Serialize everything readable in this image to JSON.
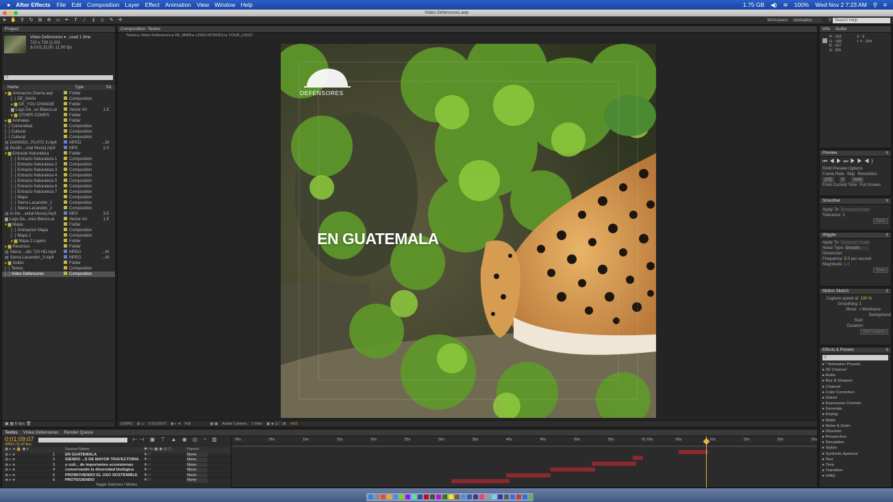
{
  "menubar": {
    "app": "After Effects",
    "items": [
      "File",
      "Edit",
      "Composition",
      "Layer",
      "Effect",
      "Animation",
      "View",
      "Window",
      "Help"
    ],
    "status": [
      "1.75 GB",
      "100%",
      "Wed Nov 2  7:23 AM"
    ]
  },
  "window_title": "Video Defensores.aep",
  "workspace": {
    "label": "Workspace:",
    "value": "Animation",
    "search_placeholder": "Search Help"
  },
  "project": {
    "tab": "Project",
    "comp_name": "Video Defensores ▾ , used 1 time",
    "comp_size": "720 x 720 (1.00)",
    "comp_duration": "Δ 0;01;21;00, 11.00 fps",
    "search_placeholder": "",
    "col_name": "Name",
    "col_type": "Type",
    "col_size": "Siz",
    "rows": [
      {
        "name": "Animacion Diarria.aep",
        "type": "Folder",
        "size": "",
        "color": "#c7b93a",
        "depth": 0,
        "icon": "▾ ▆"
      },
      {
        "name": "DE_MAIN",
        "type": "Composition",
        "size": "",
        "color": "#c7b93a",
        "depth": 1,
        "icon": "[··]"
      },
      {
        "name": "DE_YOU CHANGE",
        "type": "Folder",
        "size": "",
        "color": "#c7b93a",
        "depth": 1,
        "icon": "▸ ▆"
      },
      {
        "name": "Logo De...es Blanco.ai",
        "type": "Vector Art",
        "size": "1.5",
        "color": "#c7b93a",
        "depth": 1,
        "icon": "▆"
      },
      {
        "name": "OTHER COMPS",
        "type": "Folder",
        "size": "",
        "color": "#c7b93a",
        "depth": 1,
        "icon": "▸ ▆"
      },
      {
        "name": "Animales",
        "type": "Folder",
        "size": "",
        "color": "#c7b93a",
        "depth": 0,
        "icon": "▸ ▆"
      },
      {
        "name": "Comunidad",
        "type": "Composition",
        "size": "",
        "color": "#c7b93a",
        "depth": 0,
        "icon": "[··]"
      },
      {
        "name": "Cultural",
        "type": "Composition",
        "size": "",
        "color": "#c7b93a",
        "depth": 0,
        "icon": "[··]"
      },
      {
        "name": "Cultural",
        "type": "Composition",
        "size": "",
        "color": "#c7b93a",
        "depth": 0,
        "icon": "[··]"
      },
      {
        "name": "DANNSO...PLATO 3.mp4",
        "type": "MPEG",
        "size": "...M",
        "color": "#6a7ad8",
        "depth": 0,
        "icon": "▤"
      },
      {
        "name": "Dustin ...oral Music].mp3",
        "type": "MP3",
        "size": "2.0",
        "color": "#6a7ad8",
        "depth": 0,
        "icon": "▤"
      },
      {
        "name": "Entracte Naturaleza",
        "type": "Folder",
        "size": "",
        "color": "#c7b93a",
        "depth": 0,
        "icon": "▾ ▆"
      },
      {
        "name": "Entracto Naturaleza 1",
        "type": "Composition",
        "size": "",
        "color": "#c7b93a",
        "depth": 1,
        "icon": "[··]"
      },
      {
        "name": "Entracto Naturaleza 2",
        "type": "Composition",
        "size": "",
        "color": "#c7b93a",
        "depth": 1,
        "icon": "[··]"
      },
      {
        "name": "Entracto Naturaleza 3",
        "type": "Composition",
        "size": "",
        "color": "#c7b93a",
        "depth": 1,
        "icon": "[··]"
      },
      {
        "name": "Entracto Naturaleza 4",
        "type": "Composition",
        "size": "",
        "color": "#c7b93a",
        "depth": 1,
        "icon": "[··]"
      },
      {
        "name": "Entracto Naturaleza 5",
        "type": "Composition",
        "size": "",
        "color": "#c7b93a",
        "depth": 1,
        "icon": "[··]"
      },
      {
        "name": "Entracto Naturaleza 6",
        "type": "Composition",
        "size": "",
        "color": "#c7b93a",
        "depth": 1,
        "icon": "[··]"
      },
      {
        "name": "Entracto Naturaleza 7",
        "type": "Composition",
        "size": "",
        "color": "#c7b93a",
        "depth": 1,
        "icon": "[··]"
      },
      {
        "name": "Mapa",
        "type": "Composition",
        "size": "",
        "color": "#c7b93a",
        "depth": 1,
        "icon": "[··]"
      },
      {
        "name": "Sierra Lacandón_1",
        "type": "Composition",
        "size": "",
        "color": "#c7b93a",
        "depth": 1,
        "icon": "[··]"
      },
      {
        "name": "Sierra Lacandón_2",
        "type": "Composition",
        "size": "",
        "color": "#c7b93a",
        "depth": 1,
        "icon": "[··]"
      },
      {
        "name": "In the ...ental Music).mp3",
        "type": "MP3",
        "size": "3.5",
        "color": "#6a7ad8",
        "depth": 0,
        "icon": "▤"
      },
      {
        "name": "Logo De...ores Blanco.ai",
        "type": "Vector Art",
        "size": "1.5",
        "color": "#c7b93a",
        "depth": 0,
        "icon": "▆"
      },
      {
        "name": "Mapa",
        "type": "Folder",
        "size": "",
        "color": "#c7b93a",
        "depth": 0,
        "icon": "▾ ▆"
      },
      {
        "name": "Animacion Mapa",
        "type": "Composition",
        "size": "",
        "color": "#c7b93a",
        "depth": 1,
        "icon": "[··]"
      },
      {
        "name": "Mapa 2",
        "type": "Composition",
        "size": "",
        "color": "#c7b93a",
        "depth": 1,
        "icon": "[··]"
      },
      {
        "name": "Mapa 2 Layers",
        "type": "Folder",
        "size": "",
        "color": "#c7b93a",
        "depth": 1,
        "icon": "▸ ▆"
      },
      {
        "name": "Recursos",
        "type": "Folder",
        "size": "",
        "color": "#c7b93a",
        "depth": 0,
        "icon": "▸ ▆"
      },
      {
        "name": "Sierra ...olls 720 HD.mp4",
        "type": "MPEG",
        "size": "...M",
        "color": "#6a7ad8",
        "depth": 0,
        "icon": "▤"
      },
      {
        "name": "Sierra Lacandón_3.mp4",
        "type": "MPEG",
        "size": "...M",
        "color": "#6a7ad8",
        "depth": 0,
        "icon": "▤"
      },
      {
        "name": "Solids",
        "type": "Folder",
        "size": "",
        "color": "#c7b93a",
        "depth": 0,
        "icon": "▸ ▆"
      },
      {
        "name": "Textos",
        "type": "Composition",
        "size": "",
        "color": "#c7b93a",
        "depth": 0,
        "icon": "[··]"
      },
      {
        "name": "Video Defensores",
        "type": "Composition",
        "size": "",
        "color": "#c7b93a",
        "depth": 0,
        "icon": "[··]",
        "selected": true
      }
    ],
    "footer_bpc": "8 bpc"
  },
  "composition": {
    "tab": "Composition: Textos",
    "breadcrumbs": [
      "Textos",
      "Video Defensores",
      "DE_MAIN",
      "LOGO INTRODU",
      "YOUR_LOGO"
    ],
    "overlay_text": "EN GUATEMALA",
    "logo_text": "DEFENSORES",
    "zoom": "(100%)",
    "timecode": "0;01;09;07",
    "resolution": "Full",
    "camera": "Active Camera",
    "views": "1 View",
    "exposure": "+0.0"
  },
  "info": {
    "tabs": [
      "Info",
      "Audio"
    ],
    "r": "R : 162",
    "g": "G : 160",
    "b": "B : 157",
    "a": "A : 255",
    "x": "X : 9",
    "y": "+ Y : 324"
  },
  "preview": {
    "tab": "Preview",
    "options": "RAM Preview Options",
    "frame_rate_label": "Frame Rate",
    "skip_label": "Skip",
    "resolution_label": "Resolution",
    "frame_rate": "(15)",
    "skip": "0",
    "resolution": "Auto",
    "from_current": "From Current Time",
    "full_screen": "Full Screen"
  },
  "smoother": {
    "tab": "Smoother",
    "apply_to_label": "Apply To:",
    "apply_to": "Temporal Graph",
    "tolerance_label": "Tolerance:",
    "tolerance": "1",
    "apply": "Apply"
  },
  "wiggler": {
    "tab": "Wiggler",
    "apply_to_label": "Apply To:",
    "apply_to": "Temporal Graph",
    "noise_label": "Noise Type:",
    "noise": "Smooth",
    "dimensions_label": "Dimension:",
    "frequency_label": "Frequency:",
    "frequency": "5.0",
    "frequency_unit": "per second",
    "magnitude_label": "Magnitude:",
    "magnitude": "1.0",
    "apply": "Apply"
  },
  "motion_sketch": {
    "tab": "Motion Sketch",
    "capture_label": "Capture speed at:",
    "capture": "100 %",
    "smoothing_label": "Smoothing:",
    "smoothing": "1",
    "show_label": "Show:",
    "wireframe": "Wireframe",
    "background": "Background",
    "start_label": "Start:",
    "duration_label": "Duration:",
    "start_capture": "Start Capture"
  },
  "effects": {
    "tab": "Effects & Presets",
    "search_placeholder": "",
    "items": [
      "* Animation Presets",
      "3D Channel",
      "Audio",
      "Blur & Sharpen",
      "Channel",
      "Color Correction",
      "Distort",
      "Expression Controls",
      "Generate",
      "Keying",
      "Matte",
      "Noise & Grain",
      "Obsolete",
      "Perspective",
      "Simulation",
      "Stylize",
      "Synthetic Aperture",
      "Text",
      "Time",
      "Transition",
      "Utility"
    ]
  },
  "timeline": {
    "tabs": [
      "Textos",
      "Video Defensores",
      "Render Queue"
    ],
    "timecode": "0;01;09;07",
    "frames": "00862 (11.00 fps)",
    "col_layer": "Source Name",
    "col_parent": "Parent",
    "ruler": [
      "00s",
      "05s",
      "10s",
      "15s",
      "20s",
      "25s",
      "30s",
      "35s",
      "40s",
      "45s",
      "50s",
      "55s",
      "01:00s",
      "05s",
      "10s",
      "15s",
      "20s",
      "25s"
    ],
    "layers": [
      {
        "num": "1",
        "name": "EN GUATEMALA",
        "parent": "None"
      },
      {
        "num": "2",
        "name": "SIENDO ...S  DE MAYOR  TRAYECTORIA",
        "parent": "None"
      },
      {
        "num": "3",
        "name": "y cult... de importantes  ecosistemas",
        "parent": "None"
      },
      {
        "num": "4",
        "name": "conservando  la  diversidad biológica",
        "parent": "None"
      },
      {
        "num": "5",
        "name": "PROMOVIENDO  EL  USO  SOSTENIBLE",
        "parent": "None"
      },
      {
        "num": "6",
        "name": "PROTEGIENDO",
        "parent": "None"
      }
    ],
    "toggle": "Toggle Switches / Modes"
  }
}
